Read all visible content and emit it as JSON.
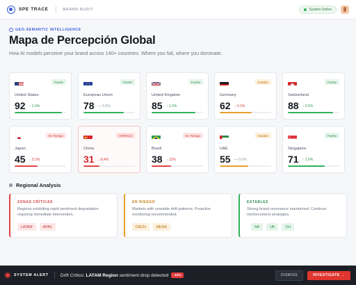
{
  "nav": {
    "brand": "SPE TRACE",
    "section": "BRAND AUDIT",
    "status": "System Online"
  },
  "header": {
    "eyebrow": "GEO-SEMANTIC INTELLIGENCE",
    "title": "Mapa de Percepción Global",
    "subtitle": "How AI models perceive your brand across 140+ countries. Where you fail, where you dominate."
  },
  "colors": {
    "strong": "#2fb35a",
    "stable": "#e8a02a",
    "risk": "#e04343",
    "accent": "#3a5bd9"
  },
  "countries": [
    {
      "name": "United States",
      "badge": "Fuerte",
      "score": "92",
      "delta": "↑ 2.4%",
      "progress": 0.92,
      "level": "strong",
      "trend": "up",
      "flag": "us"
    },
    {
      "name": "European Union",
      "badge": "Fuerte",
      "score": "78",
      "delta": "— 0.0%",
      "progress": 0.78,
      "level": "strong",
      "trend": "flat",
      "flag": "eu"
    },
    {
      "name": "United Kingdom",
      "badge": "Fuerte",
      "score": "85",
      "delta": "↑ 1.2%",
      "progress": 0.85,
      "level": "strong",
      "trend": "up",
      "flag": "uk"
    },
    {
      "name": "Germany",
      "badge": "Estable",
      "score": "62",
      "delta": "↓ 0.1%",
      "progress": 0.62,
      "level": "stable",
      "trend": "down",
      "flag": "de"
    },
    {
      "name": "Switzerland",
      "badge": "Fuerte",
      "score": "88",
      "delta": "↑ 0.5%",
      "progress": 0.88,
      "level": "strong",
      "trend": "up",
      "flag": "ch"
    },
    {
      "name": "Japan",
      "badge": "En Riesgo",
      "score": "45",
      "delta": "↓ 5.2%",
      "progress": 0.45,
      "level": "risk",
      "trend": "down",
      "flag": "jp"
    },
    {
      "name": "China",
      "badge": "CRÍTICO",
      "score": "31",
      "delta": "↓ 8.4%",
      "progress": 0.31,
      "level": "crit",
      "trend": "down",
      "flag": "cn"
    },
    {
      "name": "Brazil",
      "badge": "En Riesgo",
      "score": "38",
      "delta": "↓ 12%",
      "progress": 0.38,
      "level": "risk",
      "trend": "down",
      "flag": "br"
    },
    {
      "name": "UAE",
      "badge": "Estable",
      "score": "55",
      "delta": "— 0.0%",
      "progress": 0.55,
      "level": "stable",
      "trend": "flat",
      "flag": "ae"
    },
    {
      "name": "Singapore",
      "badge": "Fuerte",
      "score": "71",
      "delta": "↑ 1.6%",
      "progress": 0.71,
      "level": "strong",
      "trend": "up",
      "flag": "sg"
    }
  ],
  "regional": {
    "title": "Regional Analysis",
    "panels": [
      {
        "head": "ZONAS CRÍTICAS",
        "desc": "Regions exhibiting rapid sentiment degradation requiring immediate intervention.",
        "tags": [
          "LATAM",
          "APAC"
        ]
      },
      {
        "head": "EN RIESGO",
        "desc": "Markets with unstable drift patterns. Proactive monitoring recommended.",
        "tags": [
          "DACH",
          "MENA"
        ]
      },
      {
        "head": "ESTABLES",
        "desc": "Strong brand resonance maintained. Continue reinforcement strategies.",
        "tags": [
          "NA",
          "UK",
          "CH"
        ]
      }
    ]
  },
  "alert": {
    "label": "SYSTEM ALERT",
    "prefix": "Drift Crítico: ",
    "region": "LATAM Region",
    "suffix": " sentiment drop detected",
    "chip": "-12%",
    "dismiss": "DISMISS",
    "investigate": "INVESTIGATE →"
  }
}
